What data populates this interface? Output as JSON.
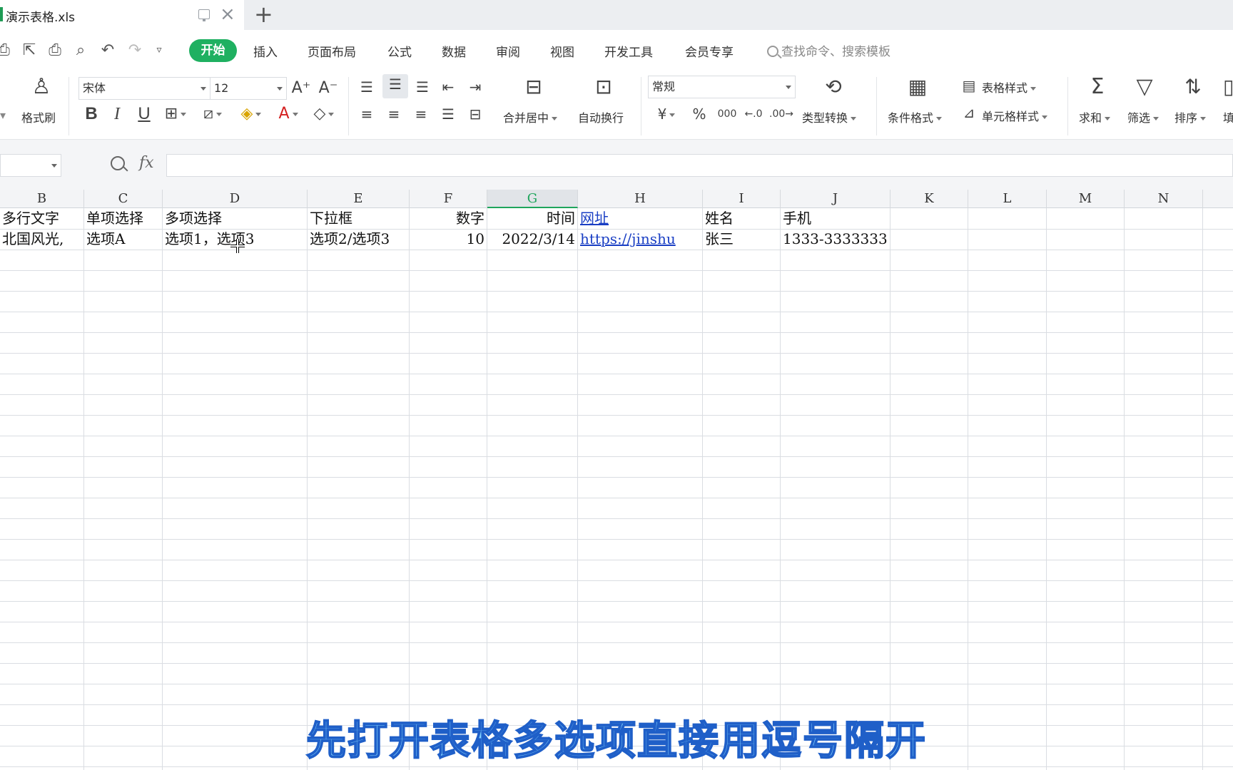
{
  "tab": {
    "title": "演示表格.xls",
    "new_tab": "+"
  },
  "menu": {
    "start": "开始",
    "items": [
      "插入",
      "页面布局",
      "公式",
      "数据",
      "审阅",
      "视图",
      "开发工具",
      "会员专享"
    ],
    "search_placeholder": "查找命令、搜索模板"
  },
  "ribbon": {
    "format_painter": "格式刷",
    "font_name": "宋体",
    "font_size": "12",
    "merge_center": "合并居中",
    "wrap_text": "自动换行",
    "number_format": "常规",
    "type_convert": "类型转换",
    "cond_format": "条件格式",
    "table_style": "表格样式",
    "cell_style": "单元格样式",
    "sum": "求和",
    "filter": "筛选",
    "sort": "排序",
    "fill_partial": "填",
    "bold": "B",
    "italic": "I",
    "underline": "U",
    "currency": "¥",
    "percent": "%",
    "thousands": "000"
  },
  "formula_bar": {
    "fx": "fx",
    "value": ""
  },
  "columns": [
    "B",
    "C",
    "D",
    "E",
    "F",
    "G",
    "H",
    "I",
    "J",
    "K",
    "L",
    "M",
    "N"
  ],
  "selected_column": "G",
  "rows": [
    [
      "多行文字",
      "单项选择",
      "多项选择",
      "下拉框",
      "数字",
      "时间",
      "网址",
      "姓名",
      "手机",
      "",
      "",
      "",
      ""
    ],
    [
      "北国风光,",
      "选项A",
      "选项1，选项3",
      "选项2/选项3",
      "10",
      "2022/3/14",
      "https://jinshu",
      "张三",
      "1333-3333333",
      "",
      "",
      "",
      ""
    ]
  ],
  "subtitle": "先打开表格多选项直接用逗号隔开",
  "colors": {
    "accent": "#1fb061",
    "link": "#1a3fc4",
    "subtitle_fill": "#7fd0ff",
    "subtitle_stroke": "#1f5fc8"
  }
}
